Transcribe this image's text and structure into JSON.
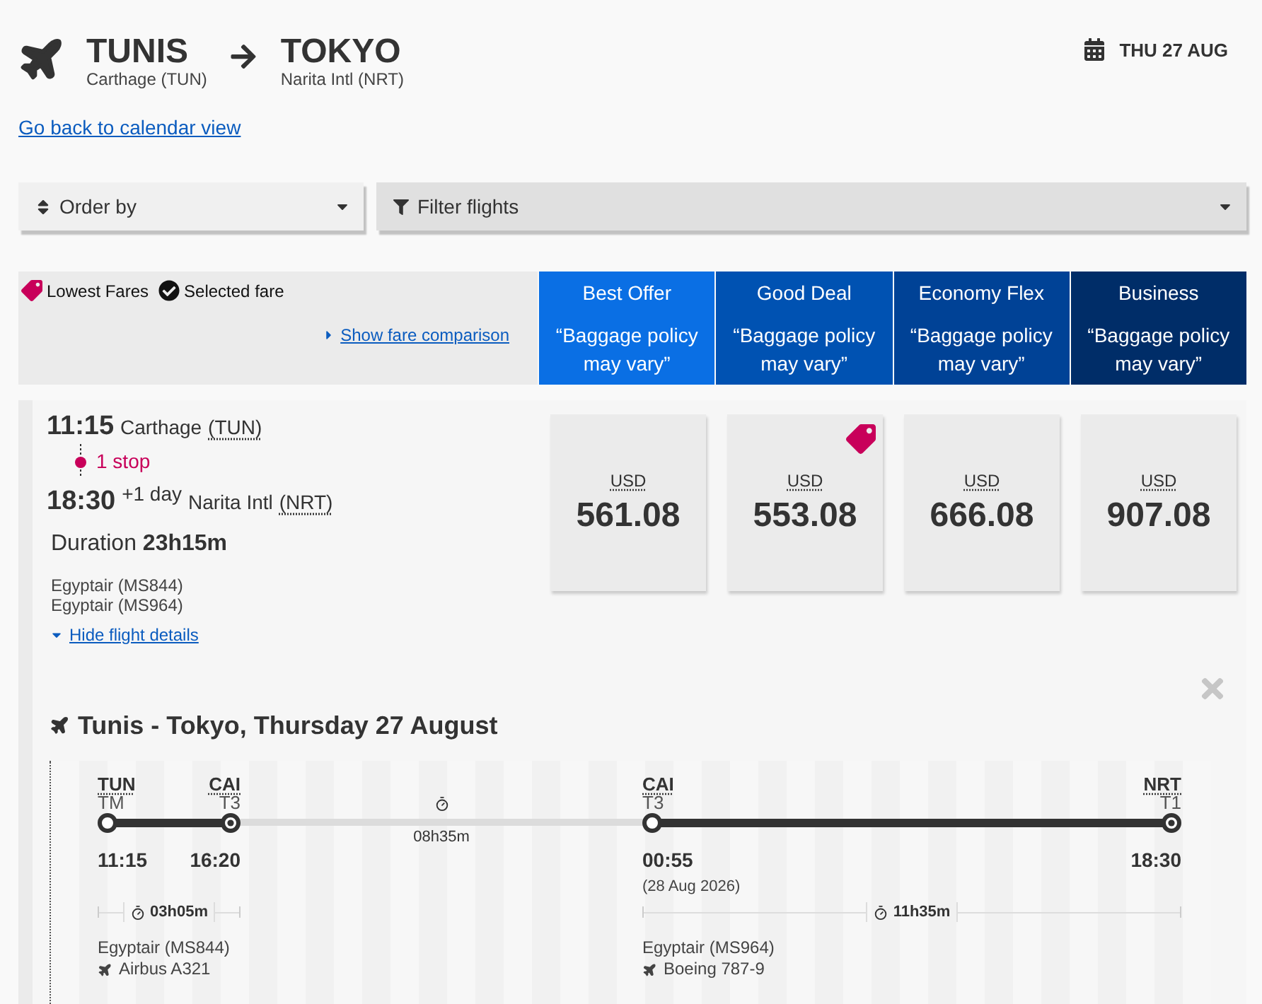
{
  "header": {
    "origin": {
      "city": "TUNIS",
      "airport": "Carthage (TUN)"
    },
    "destination": {
      "city": "TOKYO",
      "airport": "Narita Intl (NRT)"
    },
    "date": "THU 27 AUG"
  },
  "back_link": "Go back to calendar view",
  "toolbar": {
    "order_by": "Order by",
    "filter": "Filter flights"
  },
  "legend": {
    "lowest_fares": "Lowest Fares",
    "selected_fare": "Selected fare",
    "comparison_link": "Show fare comparison"
  },
  "fare_columns": [
    {
      "name": "Best Offer",
      "note": "“Baggage policy may vary”",
      "color": "#0a6fe4"
    },
    {
      "name": "Good Deal",
      "note": "“Baggage policy may vary”",
      "color": "#0052b2"
    },
    {
      "name": "Economy Flex",
      "note": "“Baggage policy may vary”",
      "color": "#004296"
    },
    {
      "name": "Business",
      "note": "“Baggage policy may vary”",
      "color": "#002d68"
    }
  ],
  "flight": {
    "departure": {
      "time": "11:15",
      "airport": "Carthage",
      "code": "(TUN)"
    },
    "stops": "1 stop",
    "arrival": {
      "time": "18:30",
      "day_offset": "+1 day",
      "airport": "Narita Intl",
      "code": "(NRT)"
    },
    "duration": "Duration **23h15m**",
    "carriers": [
      "Egyptair (MS844)",
      "Egyptair (MS964)"
    ],
    "details_link": "Hide flight details",
    "details_expanded": true,
    "fares": [
      {
        "currency": "USD",
        "price": "561.08",
        "lowest": false
      },
      {
        "currency": "USD",
        "price": "553.08",
        "lowest": true
      },
      {
        "currency": "USD",
        "price": "666.08",
        "lowest": false
      },
      {
        "currency": "USD",
        "price": "907.08",
        "lowest": false
      }
    ]
  },
  "details": {
    "title": "Tunis - Tokyo, Thursday 27 August",
    "segments": [
      {
        "departure": {
          "code": "TUN",
          "terminal": "TM",
          "time": "11:15"
        },
        "arrival": {
          "code": "CAI",
          "terminal": "T3",
          "time": "16:20"
        },
        "duration": "03h05m",
        "airline": "Egyptair (MS844)",
        "aircraft": "Airbus A321"
      },
      {
        "departure": {
          "code": "CAI",
          "terminal": "T3",
          "time": "00:55",
          "date": "(28 Aug 2026)"
        },
        "arrival": {
          "code": "NRT",
          "terminal": "T1",
          "time": "18:30"
        },
        "duration": "11h35m",
        "airline": "Egyptair (MS964)",
        "aircraft": "Boeing 787-9"
      }
    ],
    "layovers": [
      {
        "duration": "08h35m"
      }
    ]
  }
}
